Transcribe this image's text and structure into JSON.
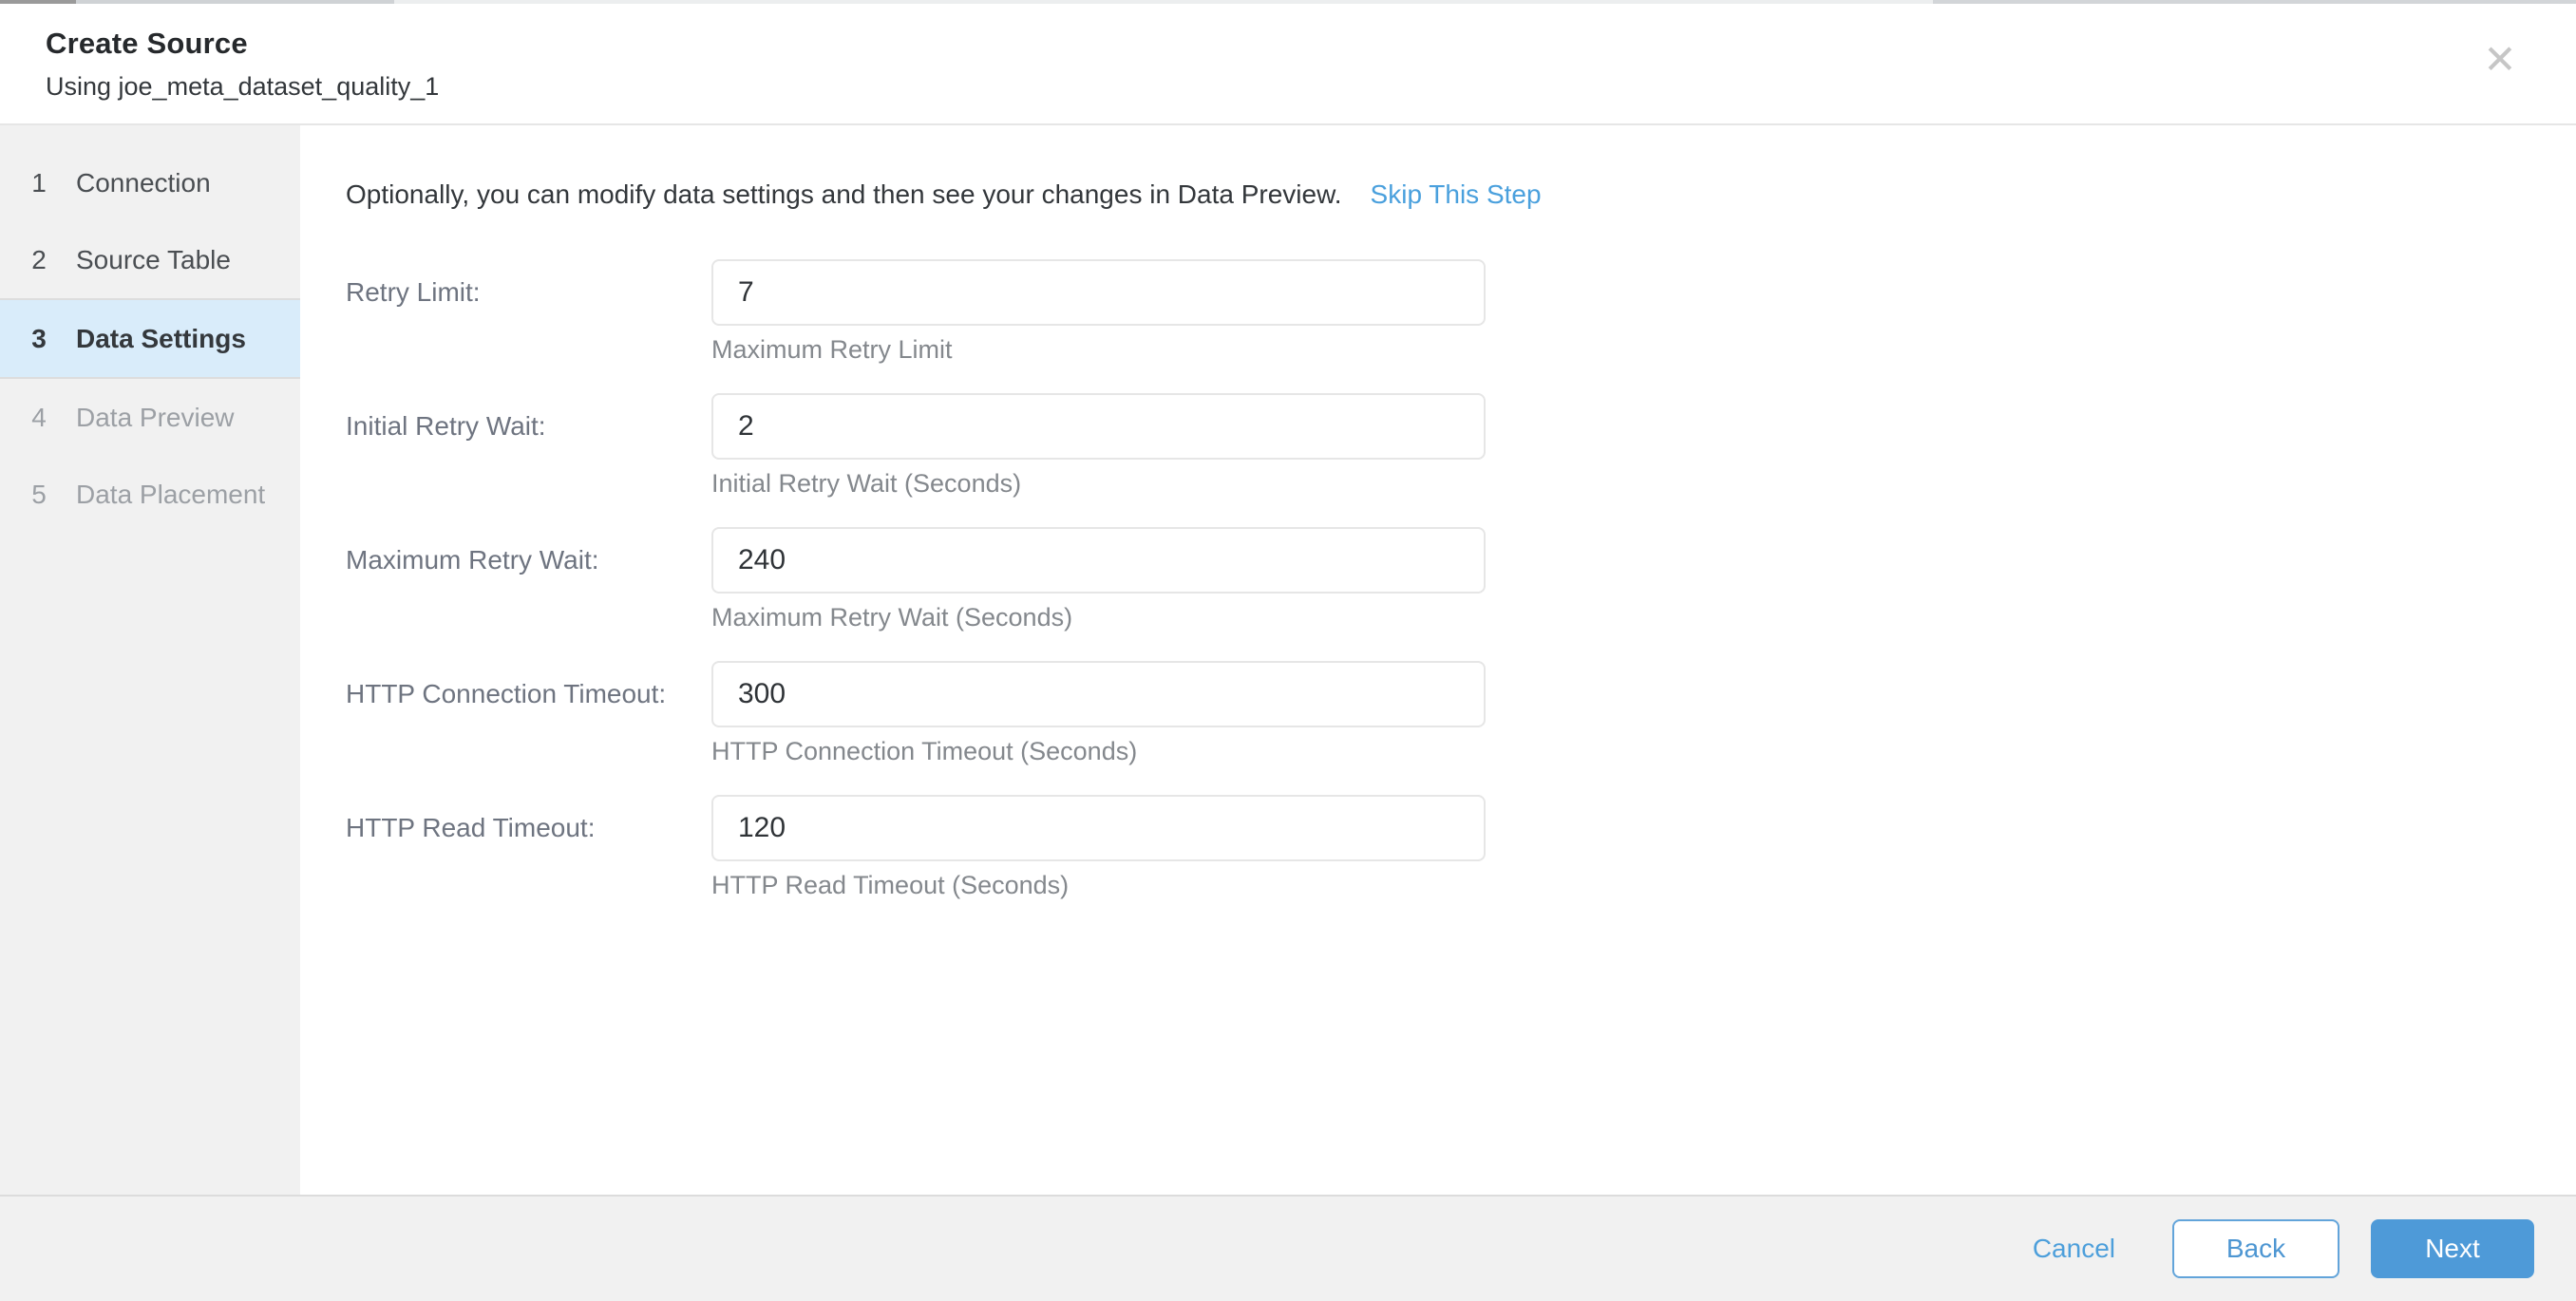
{
  "window": {
    "title": "Create Source",
    "subtitle": "Using joe_meta_dataset_quality_1",
    "close_icon": "✕"
  },
  "steps": [
    {
      "number": "1",
      "label": "Connection",
      "state": "done"
    },
    {
      "number": "2",
      "label": "Source Table",
      "state": "done"
    },
    {
      "number": "3",
      "label": "Data Settings",
      "state": "active"
    },
    {
      "number": "4",
      "label": "Data Preview",
      "state": "upcoming"
    },
    {
      "number": "5",
      "label": "Data Placement",
      "state": "upcoming"
    }
  ],
  "content": {
    "intro": "Optionally, you can modify data settings and then see your changes in Data Preview.",
    "skip_link": "Skip This Step",
    "fields": [
      {
        "label": "Retry Limit:",
        "value": "7",
        "helper": "Maximum Retry Limit"
      },
      {
        "label": "Initial Retry Wait:",
        "value": "2",
        "helper": "Initial Retry Wait (Seconds)"
      },
      {
        "label": "Maximum Retry Wait:",
        "value": "240",
        "helper": "Maximum Retry Wait (Seconds)"
      },
      {
        "label": "HTTP Connection Timeout:",
        "value": "300",
        "helper": "HTTP Connection Timeout (Seconds)"
      },
      {
        "label": "HTTP Read Timeout:",
        "value": "120",
        "helper": "HTTP Read Timeout (Seconds)"
      }
    ]
  },
  "footer": {
    "cancel_label": "Cancel",
    "back_label": "Back",
    "next_label": "Next"
  },
  "colors": {
    "accent_blue": "#4e9ad8",
    "link_blue": "#4aa0dd",
    "active_step_bg": "#d9ecfa",
    "sidebar_bg": "#f1f1f1"
  }
}
